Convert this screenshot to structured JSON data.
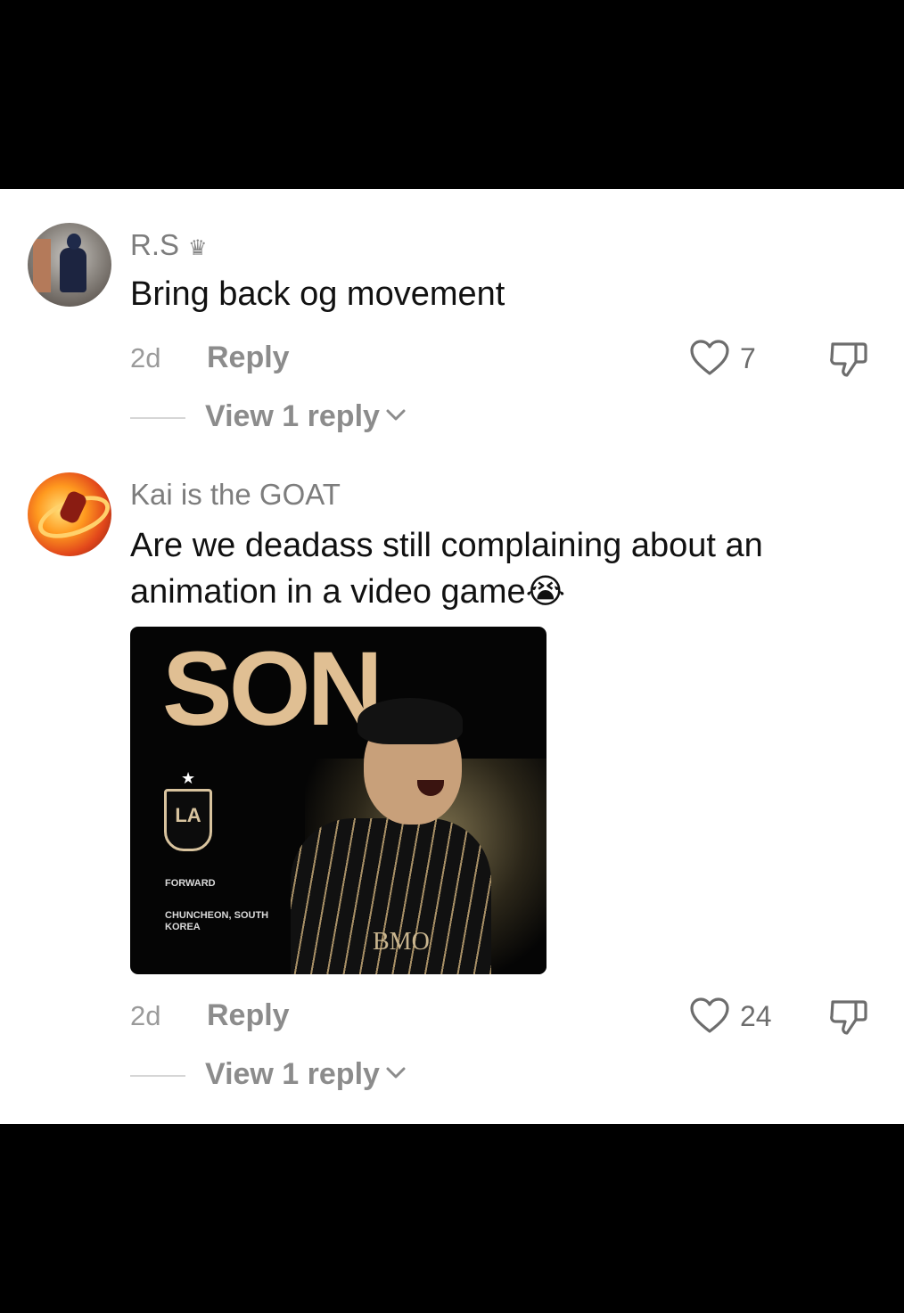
{
  "comments": [
    {
      "username": "R.S",
      "badge": "♛",
      "text": "Bring back og movement",
      "time": "2d",
      "reply_label": "Reply",
      "likes": "7",
      "view_replies_label": "View 1 reply"
    },
    {
      "username": "Kai is the GOAT",
      "text": "Are we deadass still complaining about an animation in a video game😭",
      "sticker": {
        "title": "SON",
        "star": "★",
        "crest_text": "LA",
        "position": "FORWARD",
        "origin": "CHUNCHEON, SOUTH KOREA",
        "sponsor": "BMO"
      },
      "time": "2d",
      "reply_label": "Reply",
      "likes": "24",
      "view_replies_label": "View 1 reply"
    }
  ],
  "icons": {
    "like": "heart-outline-icon",
    "dislike": "thumbs-down-icon",
    "expand": "chevron-down-icon",
    "badge": "crown-icon"
  },
  "colors": {
    "background": "#ffffff",
    "text_primary": "#111111",
    "text_secondary": "#8c8c8c",
    "letterbox": "#000000"
  }
}
